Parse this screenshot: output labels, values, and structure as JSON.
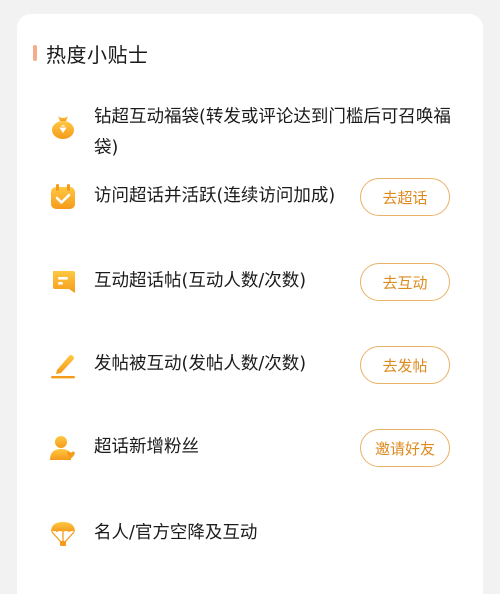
{
  "card": {
    "title": "热度小贴士"
  },
  "tips": [
    {
      "icon": "lucky-bag-icon",
      "text": "钻超互动福袋(转发或评论达到门槛后可召唤福袋)",
      "button": null
    },
    {
      "icon": "calendar-check-icon",
      "text": "访问超话并活跃(连续访问加成)",
      "button": "去超话"
    },
    {
      "icon": "post-icon",
      "text": "互动超话帖(互动人数/次数)",
      "button": "去互动"
    },
    {
      "icon": "pen-write-icon",
      "text": "发帖被互动(发帖人数/次数)",
      "button": "去发帖"
    },
    {
      "icon": "user-heart-icon",
      "text": "超话新增粉丝",
      "button": "邀请好友"
    },
    {
      "icon": "parachute-icon",
      "text": "名人/官方空降及互动",
      "button": null
    }
  ],
  "colors": {
    "accent_orange": "#f5a623",
    "button_text": "#dd8a1f",
    "button_border": "#e9b36a",
    "title_bar": "#f3ad8e"
  }
}
